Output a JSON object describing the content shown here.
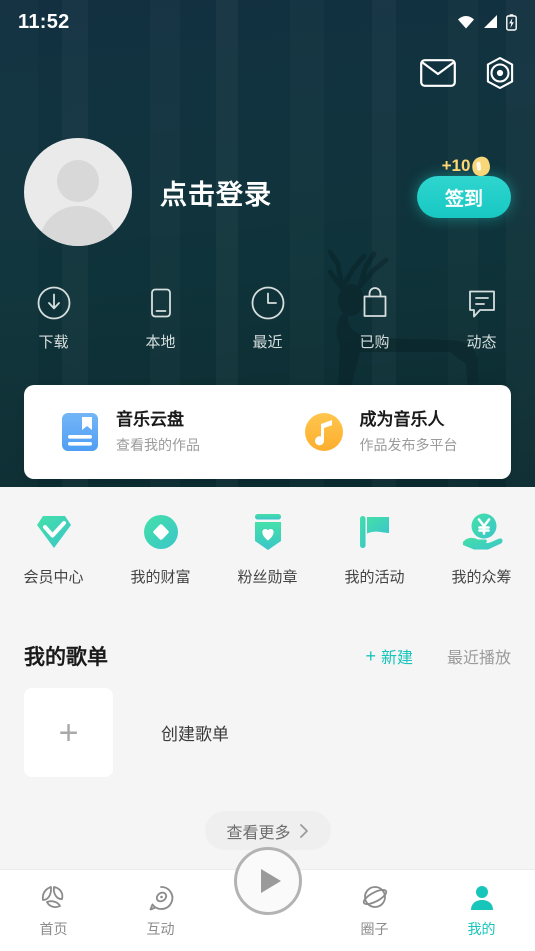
{
  "status_bar": {
    "time": "11:52",
    "icons": [
      "wifi-icon",
      "cellular-signal-icon",
      "battery-charging-icon"
    ]
  },
  "header": {
    "top_actions": [
      {
        "name": "mail-icon",
        "label": "信箱"
      },
      {
        "name": "settings-icon",
        "label": "设置"
      }
    ],
    "profile": {
      "avatar": "default-avatar",
      "login_text": "点击登录"
    },
    "signin": {
      "badge_text": "+10",
      "badge_icon": "coin-icon",
      "button_label": "签到"
    },
    "quick_nav": [
      {
        "icon": "download-circle-icon",
        "label": "下载"
      },
      {
        "icon": "phone-icon",
        "label": "本地"
      },
      {
        "icon": "clock-icon",
        "label": "最近"
      },
      {
        "icon": "shopping-bag-icon",
        "label": "已购"
      },
      {
        "icon": "message-icon",
        "label": "动态"
      }
    ]
  },
  "cloud_card": [
    {
      "icon": "cloud-disk-icon",
      "title": "音乐云盘",
      "subtitle": "查看我的作品"
    },
    {
      "icon": "music-note-icon",
      "title": "成为音乐人",
      "subtitle": "作品发布多平台"
    }
  ],
  "entries": [
    {
      "icon": "vip-diamond-icon",
      "label": "会员中心"
    },
    {
      "icon": "coin-circle-icon",
      "label": "我的财富"
    },
    {
      "icon": "medal-heart-icon",
      "label": "粉丝勋章"
    },
    {
      "icon": "flag-icon",
      "label": "我的活动"
    },
    {
      "icon": "crowdfunding-hand-icon",
      "label": "我的众筹"
    }
  ],
  "playlists": {
    "section_title": "我的歌单",
    "new_label": "新建",
    "new_plus": "+",
    "recent_label": "最近播放",
    "create_plus": "+",
    "create_label": "创建歌单",
    "more_label": "查看更多"
  },
  "tabbar": [
    {
      "icon": "home-icon",
      "label": "首页",
      "active": false
    },
    {
      "icon": "interaction-icon",
      "label": "互动",
      "active": false
    },
    {
      "icon": "play-icon",
      "label": "",
      "active": false
    },
    {
      "icon": "circle-community-icon",
      "label": "圈子",
      "active": false
    },
    {
      "icon": "person-icon",
      "label": "我的",
      "active": true
    }
  ],
  "colors": {
    "accent_teal": "#17c5bb",
    "header_dark": "#11333f",
    "gold": "#ffd873",
    "page_bg": "#f5f5f5"
  }
}
